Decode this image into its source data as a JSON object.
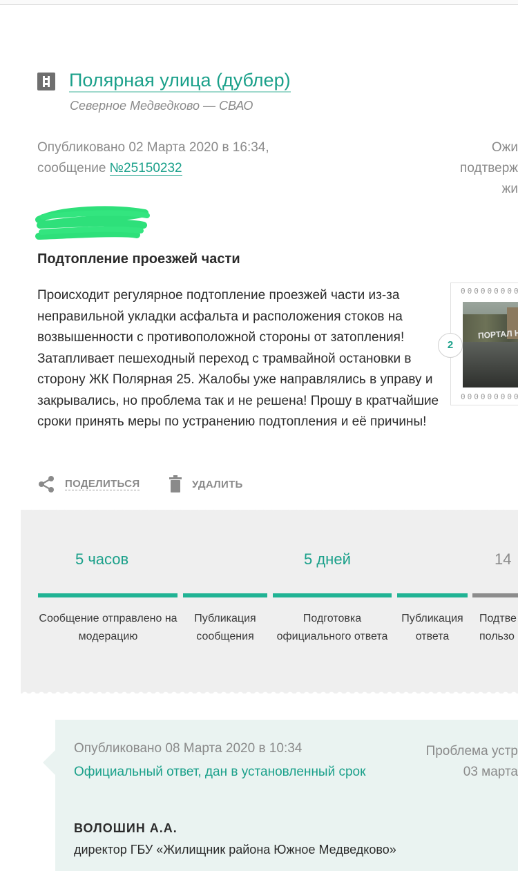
{
  "address": {
    "title": "Полярная улица (дублер)",
    "district": "Северное Медведково — СВАО",
    "icon": "building-icon"
  },
  "publication": {
    "line1": "Опубликовано 02 Марта 2020 в 16:34,",
    "message_prefix": "сообщение",
    "message_number": "№25150232"
  },
  "status_right": {
    "line1": "Ожи",
    "line2": "подтверж",
    "line3": "жи"
  },
  "message": {
    "title": "Подтопление проезжей части",
    "body": "Происходит регулярное подтопление проезжей части из-за неправильной укладки асфальта и расположения стоков на возвышенности с противоположной стороны от затопления! Затапливает пешеходный переход с трамвайной остановки в сторону ЖК Полярная 25. Жалобы уже направлялись в управу и закрывались, но проблема так и не решена! Прошу в кратчайшие сроки принять меры по устранению подтопления и её причины!"
  },
  "photos": {
    "count": "2",
    "watermark": "ПОРТАЛ Н",
    "perforation": "000000000"
  },
  "actions": {
    "share_label": "ПОДЕЛИТЬСЯ",
    "delete_label": "УДАЛИТЬ"
  },
  "timeline": {
    "steps": [
      {
        "value": "5 часов",
        "label": "Сообщение отправлено на модерацию",
        "done": true
      },
      {
        "value": "",
        "label": "Публикация сообщения",
        "done": true
      },
      {
        "value": "5 дней",
        "label": "Подготовка официального ответа",
        "done": true
      },
      {
        "value": "",
        "label": "Публикация ответа",
        "done": true
      },
      {
        "value": "14",
        "label": "Подтве... пользо...",
        "done": false
      }
    ],
    "step5_line1": "Подтве",
    "step5_line2": "пользо"
  },
  "answer": {
    "published": "Опубликовано 08 Марта 2020 в 10:34",
    "official": "Официальный ответ, дан в установленный срок",
    "right_line1": "Проблема устр",
    "right_line2": "03 марта",
    "author_name": "ВОЛОШИН А.А.",
    "author_position": "директор ГБУ «Жилищник района Южное Медведково»"
  },
  "colors": {
    "accent": "#1aa08a",
    "progress_done": "#20b394",
    "progress_pending": "#8c8c8c",
    "muted_text": "#8a8a8a",
    "timeline_bg": "#efefef",
    "answer_bg": "#eaf3f1"
  }
}
